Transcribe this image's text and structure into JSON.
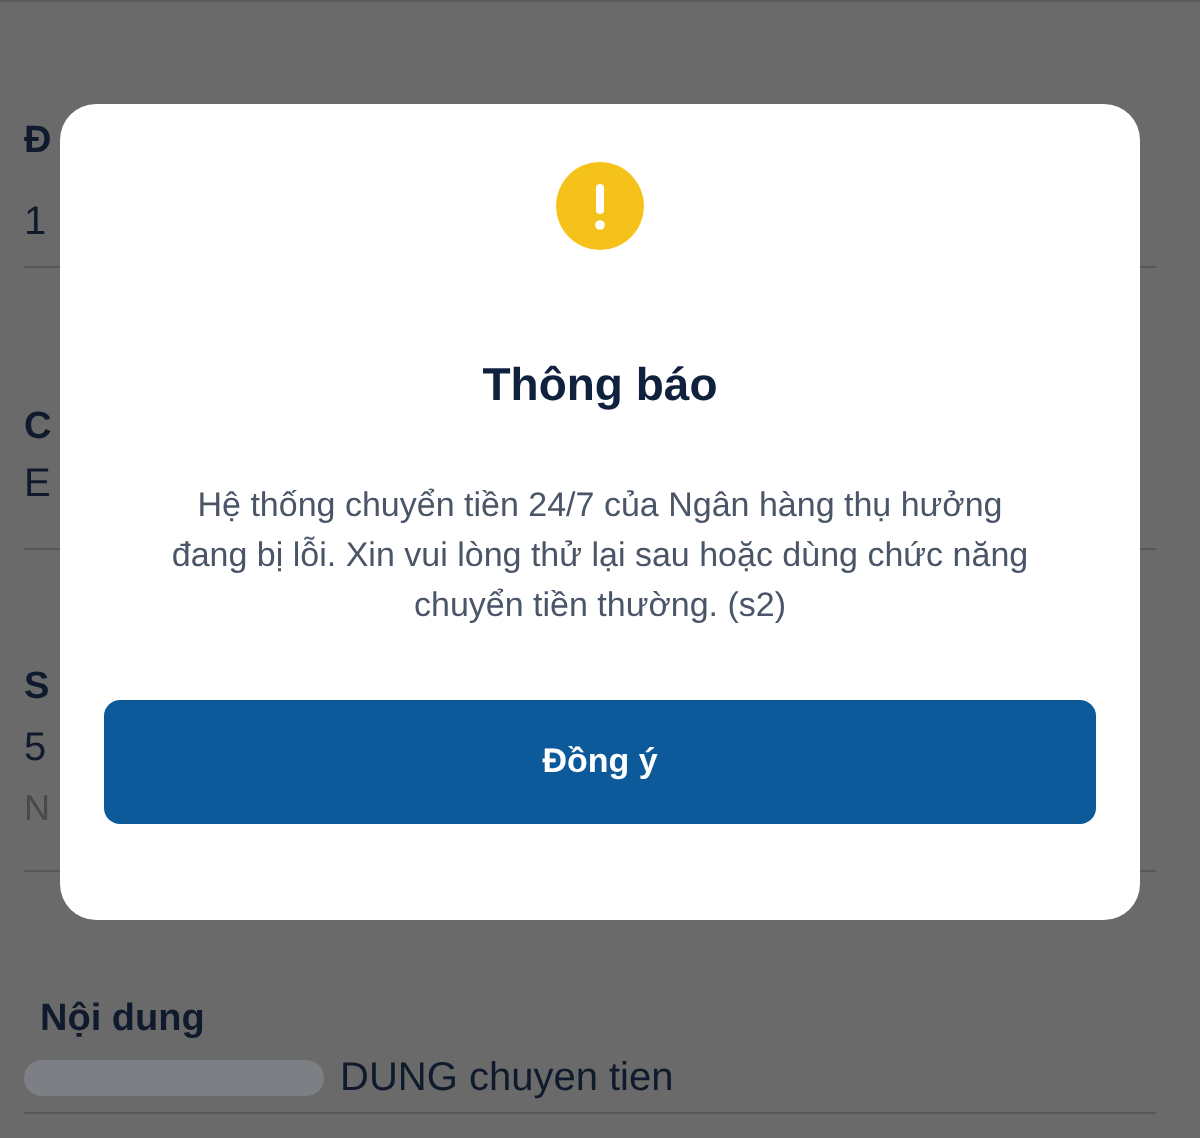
{
  "background_fields": [
    {
      "lines": [
        {
          "kind": "label",
          "text": "Đ"
        },
        {
          "kind": "value",
          "text": "1"
        }
      ]
    },
    {
      "lines": [
        {
          "kind": "label",
          "text": "C"
        },
        {
          "kind": "value",
          "text": "E"
        }
      ]
    },
    {
      "lines": [
        {
          "kind": "label",
          "text": "S"
        },
        {
          "kind": "value",
          "text": "5"
        },
        {
          "kind": "hint",
          "text": "N"
        }
      ]
    },
    {
      "lines": [
        {
          "kind": "label",
          "text": "Nội dung"
        },
        {
          "kind": "value",
          "text": "DUNG chuyen tien",
          "redacted": true
        }
      ]
    }
  ],
  "dialog": {
    "title": "Thông báo",
    "message": "Hệ thống chuyển tiền 24/7 của Ngân hàng thụ hưởng đang bị lỗi. Xin vui lòng thử lại sau hoặc dùng chức năng chuyển tiền thường. (s2)",
    "button": "Đồng ý"
  }
}
